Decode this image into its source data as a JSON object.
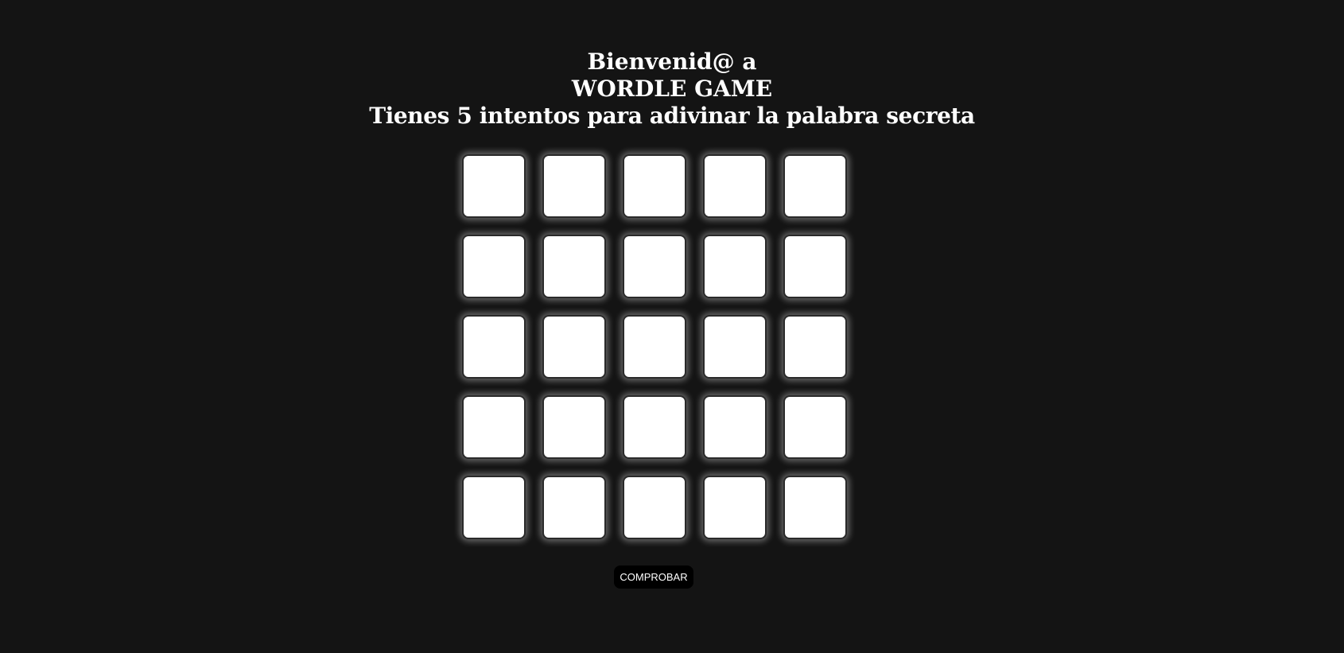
{
  "header": {
    "line1": "Bienvenid@ a",
    "line2": "WORDLE GAME",
    "line3": "Tienes 5 intentos para adivinar la palabra secreta"
  },
  "board": {
    "rows": 5,
    "cols": 5,
    "cells": [
      [
        "",
        "",
        "",
        "",
        ""
      ],
      [
        "",
        "",
        "",
        "",
        ""
      ],
      [
        "",
        "",
        "",
        "",
        ""
      ],
      [
        "",
        "",
        "",
        "",
        ""
      ],
      [
        "",
        "",
        "",
        "",
        ""
      ]
    ]
  },
  "actions": {
    "check_label": "COMPROBAR"
  },
  "colors": {
    "background": "#141414",
    "cell": "#ffffff",
    "button": "#000000",
    "text": "#ffffff"
  }
}
